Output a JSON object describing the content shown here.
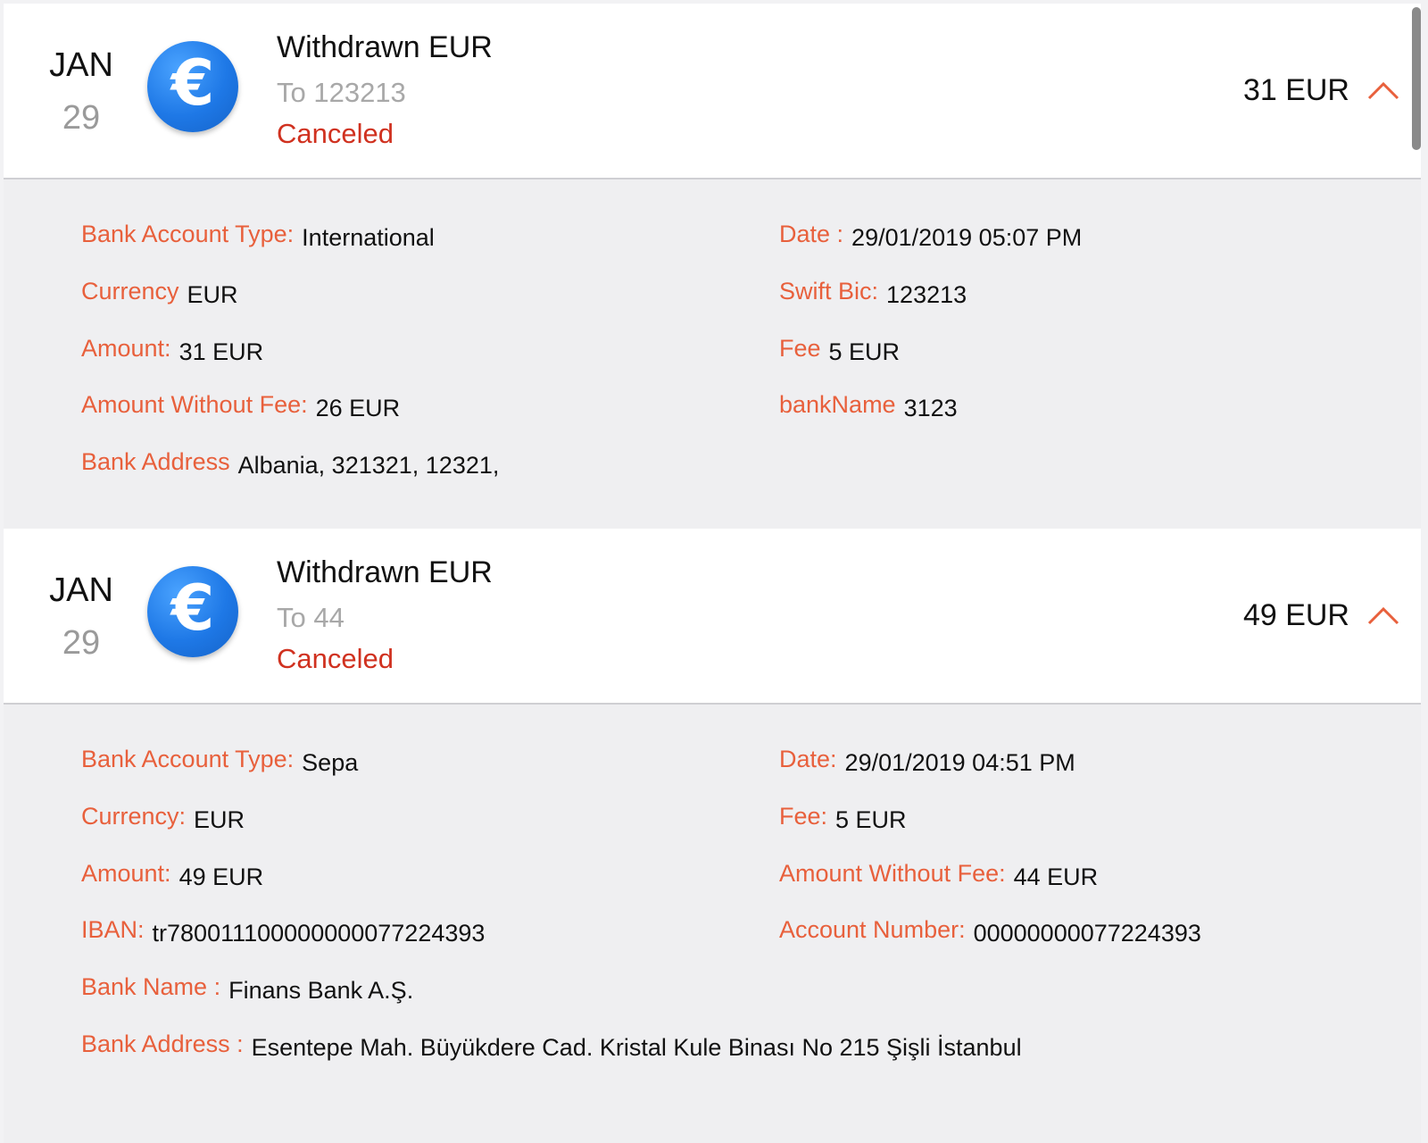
{
  "transactions": [
    {
      "month": "JAN",
      "day": "29",
      "title": "Withdrawn EUR",
      "recipient": "To 123213",
      "status": "Canceled",
      "amount": "31 EUR",
      "currency_symbol": "€",
      "details": {
        "bank_account_type_label": "Bank Account Type:",
        "bank_account_type": "International",
        "date_label": "Date :",
        "date": "29/01/2019 05:07 PM",
        "currency_label": "Currency",
        "currency": "EUR",
        "swift_label": "Swift Bic:",
        "swift": "123213",
        "amount_label": "Amount:",
        "amount": "31 EUR",
        "fee_label": "Fee",
        "fee": "5 EUR",
        "amount_without_fee_label": "Amount Without Fee:",
        "amount_without_fee": "26 EUR",
        "bank_name_label": "bankName",
        "bank_name": "3123",
        "bank_address_label": "Bank Address",
        "bank_address": "Albania, 321321, 12321,"
      }
    },
    {
      "month": "JAN",
      "day": "29",
      "title": "Withdrawn EUR",
      "recipient": "To 44",
      "status": "Canceled",
      "amount": "49 EUR",
      "currency_symbol": "€",
      "details": {
        "bank_account_type_label": "Bank Account Type:",
        "bank_account_type": "Sepa",
        "date_label": "Date:",
        "date": "29/01/2019 04:51 PM",
        "currency_label": "Currency:",
        "currency": "EUR",
        "fee_label": "Fee:",
        "fee": "5 EUR",
        "amount_label": "Amount:",
        "amount": "49 EUR",
        "amount_without_fee_label": "Amount Without Fee:",
        "amount_without_fee": "44 EUR",
        "iban_label": "IBAN:",
        "iban": "tr780011100000000077224393",
        "account_number_label": "Account Number:",
        "account_number": "00000000077224393",
        "bank_name_label": "Bank Name :",
        "bank_name": "Finans Bank A.Ş.",
        "bank_address_label": "Bank Address :",
        "bank_address": "Esentepe Mah. Büyükdere Cad. Kristal Kule Binası No 215 Şişli İstanbul"
      }
    }
  ],
  "colors": {
    "label": "#e8603c",
    "status_canceled": "#d0311f",
    "coin_blue": "#1e78e6",
    "details_bg": "#efeff1"
  },
  "icons": {
    "coin": "euro-coin-icon",
    "toggle": "chevron-up-icon"
  }
}
